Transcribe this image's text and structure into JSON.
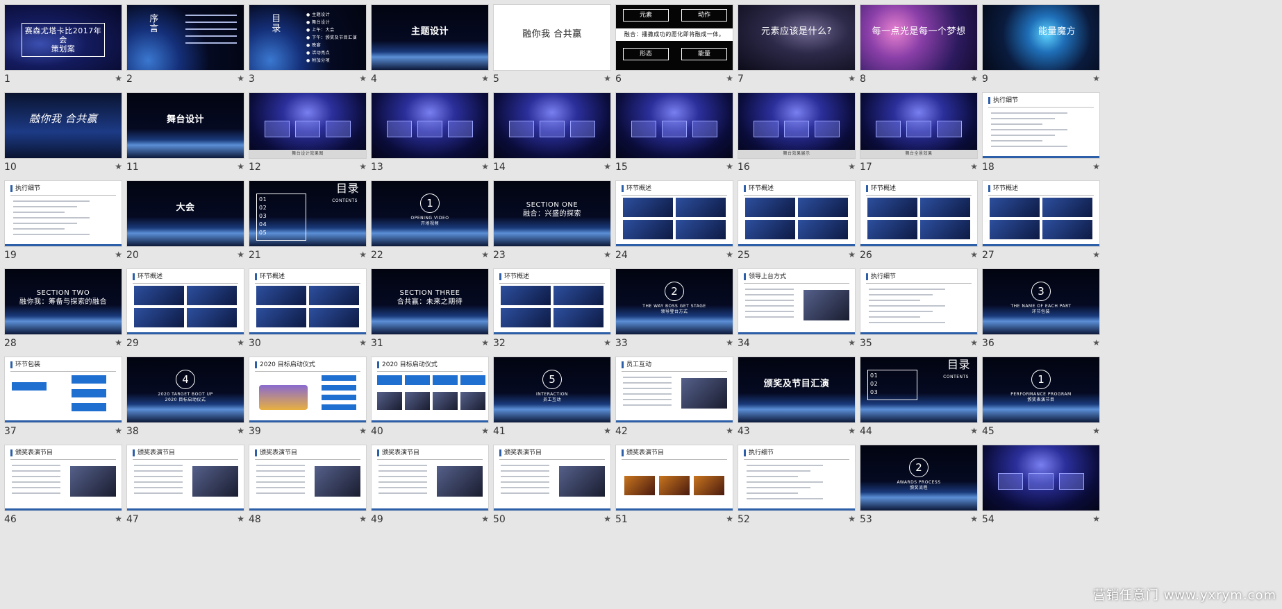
{
  "star": "★",
  "watermark": "营销任意门 www.yxrym.com",
  "slides": [
    {
      "n": "1",
      "kind": "space",
      "title": "赛森尤塔卡比2017年会\n策划案"
    },
    {
      "n": "2",
      "kind": "earth",
      "title": "序\n言"
    },
    {
      "n": "3",
      "kind": "earth",
      "title": "目\n录",
      "list": [
        "主题设计",
        "舞台设计",
        "上午：大会",
        "下午：颁奖及节目汇演",
        "晚宴",
        "活动亮点",
        "附加分项"
      ]
    },
    {
      "n": "4",
      "kind": "horizon",
      "title": "主题设计"
    },
    {
      "n": "5",
      "kind": "white",
      "title": "融你我 合共赢"
    },
    {
      "n": "6",
      "kind": "black4",
      "boxes": [
        "元素",
        "动作",
        "形态",
        "能量"
      ],
      "caption": "融合：播撒成功的愿化即将融成一体。"
    },
    {
      "n": "7",
      "kind": "milky",
      "title": "元素应该是什么?"
    },
    {
      "n": "8",
      "kind": "bubbles",
      "title": "每一点光是每一个梦想"
    },
    {
      "n": "9",
      "kind": "cube",
      "title": "能量魔方"
    },
    {
      "n": "10",
      "kind": "logo",
      "title": "融你我 合共赢"
    },
    {
      "n": "11",
      "kind": "horizon",
      "title": "舞台设计"
    },
    {
      "n": "12",
      "kind": "stage",
      "caption": "舞台设计效果图"
    },
    {
      "n": "13",
      "kind": "stage"
    },
    {
      "n": "14",
      "kind": "stage"
    },
    {
      "n": "15",
      "kind": "stage"
    },
    {
      "n": "16",
      "kind": "stage",
      "caption": "舞台效果展示"
    },
    {
      "n": "17",
      "kind": "stage",
      "caption": "舞台全景效果"
    },
    {
      "n": "18",
      "kind": "doc",
      "headline": "执行细节"
    },
    {
      "n": "19",
      "kind": "doc",
      "headline": "执行细节"
    },
    {
      "n": "20",
      "kind": "horizon",
      "title": "大会"
    },
    {
      "n": "21",
      "kind": "toc",
      "title": "目录",
      "sub": "CONTENTS",
      "list": [
        "01",
        "02",
        "03",
        "04",
        "05"
      ]
    },
    {
      "n": "22",
      "kind": "circle",
      "num": "1",
      "sub": "OPENING VIDEO\n开场视频"
    },
    {
      "n": "23",
      "kind": "section",
      "title": "SECTION ONE\n融合：兴盛的探索"
    },
    {
      "n": "24",
      "kind": "grid4",
      "headline": "环节概述"
    },
    {
      "n": "25",
      "kind": "grid4",
      "headline": "环节概述"
    },
    {
      "n": "26",
      "kind": "grid4",
      "headline": "环节概述"
    },
    {
      "n": "27",
      "kind": "grid4",
      "headline": "环节概述"
    },
    {
      "n": "28",
      "kind": "section",
      "title": "SECTION TWO\n融你我：筹备与探索的融合"
    },
    {
      "n": "29",
      "kind": "grid4",
      "headline": "环节概述"
    },
    {
      "n": "30",
      "kind": "grid4",
      "headline": "环节概述"
    },
    {
      "n": "31",
      "kind": "section",
      "title": "SECTION THREE\n合共赢：未来之期待"
    },
    {
      "n": "32",
      "kind": "grid4",
      "headline": "环节概述"
    },
    {
      "n": "33",
      "kind": "circle",
      "num": "2",
      "sub": "THE WAY BOSS GET STAGE\n领导登台方式"
    },
    {
      "n": "34",
      "kind": "docimg",
      "headline": "领导上台方式"
    },
    {
      "n": "35",
      "kind": "doc",
      "headline": "执行细节"
    },
    {
      "n": "36",
      "kind": "circle",
      "num": "3",
      "sub": "THE NAME OF EACH PART\n环节包装"
    },
    {
      "n": "37",
      "kind": "flow",
      "headline": "环节包装"
    },
    {
      "n": "38",
      "kind": "circle",
      "num": "4",
      "sub": "2020 TARGET BOOT UP\n2020 目标启动仪式"
    },
    {
      "n": "39",
      "kind": "figure",
      "headline": "2020 目标启动仪式"
    },
    {
      "n": "40",
      "kind": "flowimg",
      "headline": "2020 目标启动仪式"
    },
    {
      "n": "41",
      "kind": "circle",
      "num": "5",
      "sub": "INTERACTION\n员工互动"
    },
    {
      "n": "42",
      "kind": "docimg",
      "headline": "员工互动"
    },
    {
      "n": "43",
      "kind": "horizon",
      "title": "颁奖及节目汇演"
    },
    {
      "n": "44",
      "kind": "toc",
      "title": "目录",
      "sub": "CONTENTS",
      "list": [
        "01",
        "02",
        "03"
      ]
    },
    {
      "n": "45",
      "kind": "circle",
      "num": "1",
      "sub": "PERFORMANCE PROGRAM\n颁奖表演节目"
    },
    {
      "n": "46",
      "kind": "docimg",
      "headline": "颁奖表演节目"
    },
    {
      "n": "47",
      "kind": "docimg",
      "headline": "颁奖表演节目"
    },
    {
      "n": "48",
      "kind": "docimg",
      "headline": "颁奖表演节目"
    },
    {
      "n": "49",
      "kind": "docimg",
      "headline": "颁奖表演节目"
    },
    {
      "n": "50",
      "kind": "docimg",
      "headline": "颁奖表演节目"
    },
    {
      "n": "51",
      "kind": "doc3",
      "headline": "颁奖表演节目"
    },
    {
      "n": "52",
      "kind": "doc",
      "headline": "执行细节"
    },
    {
      "n": "53",
      "kind": "circle",
      "num": "2",
      "sub": "AWARDS PROCESS\n颁奖流程"
    },
    {
      "n": "54",
      "kind": "stage"
    }
  ]
}
